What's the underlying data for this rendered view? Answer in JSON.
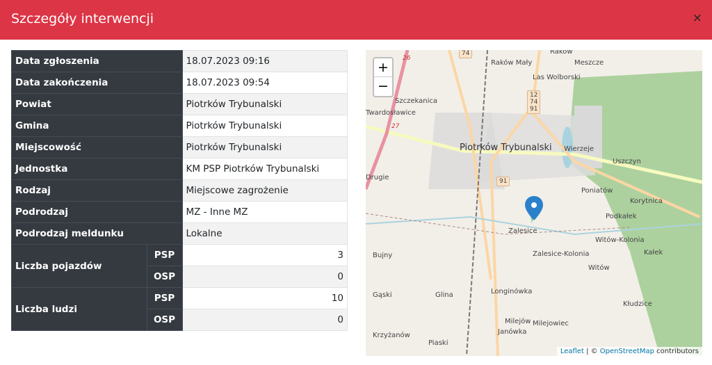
{
  "modal": {
    "title": "Szczegóły interwencji",
    "close_icon": "×"
  },
  "details": [
    {
      "label": "Data zgłoszenia",
      "value": "18.07.2023 09:16"
    },
    {
      "label": "Data zakończenia",
      "value": "18.07.2023 09:54"
    },
    {
      "label": "Powiat",
      "value": "Piotrków Trybunalski"
    },
    {
      "label": "Gmina",
      "value": "Piotrków Trybunalski"
    },
    {
      "label": "Miejscowość",
      "value": "Piotrków Trybunalski"
    },
    {
      "label": "Jednostka",
      "value": "KM PSP Piotrków Trybunalski"
    },
    {
      "label": "Rodzaj",
      "value": "Miejscowe zagrożenie"
    },
    {
      "label": "Podrodzaj",
      "value": "MZ - Inne MZ"
    },
    {
      "label": "Podrodzaj meldunku",
      "value": "Lokalne"
    }
  ],
  "vehicles": {
    "label": "Liczba pojazdów",
    "psp_label": "PSP",
    "psp": "3",
    "osp_label": "OSP",
    "osp": "0"
  },
  "people": {
    "label": "Liczba ludzi",
    "psp_label": "PSP",
    "psp": "10",
    "osp_label": "OSP",
    "osp": "0"
  },
  "map": {
    "zoom_in": "+",
    "zoom_out": "−",
    "labels": [
      "Raków",
      "Raków Mały",
      "Meszcze",
      "Las Wolborski",
      "Szczekanica",
      "Twardosławice",
      "Piotrków Trybunalski",
      "Wierzeje",
      "Uszczyn",
      "Drugie",
      "Poniatów",
      "Korytnica",
      "Podkałek",
      "Zalesice",
      "Witów-Kolonia",
      "Kałek",
      "Zalesice-Kolonia",
      "Witów",
      "Bujny",
      "Gąski",
      "Glina",
      "Longinówka",
      "Krzyżanów",
      "Kłudzice",
      "Milejów",
      "Milejowiec",
      "Janówka",
      "Piaski"
    ],
    "road_shields": [
      "74",
      "12\n74\n91",
      "91",
      "26",
      "27"
    ],
    "attribution": {
      "leaflet": "Leaflet",
      "sep": " | © ",
      "osm": "OpenStreetMap",
      "contrib": " contributors"
    },
    "marker_color": "#2a81cb"
  }
}
